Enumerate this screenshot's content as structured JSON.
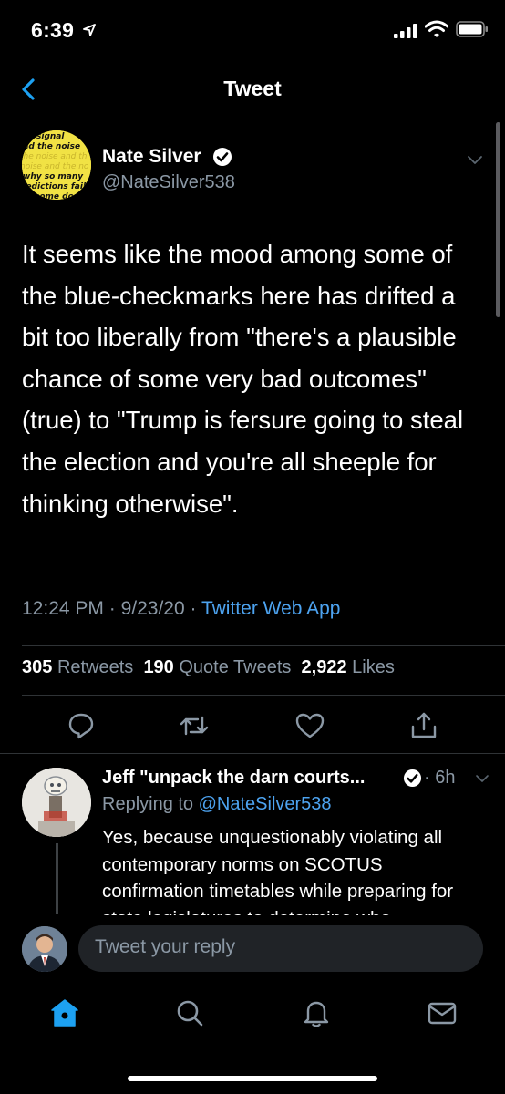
{
  "status_bar": {
    "time": "6:39"
  },
  "header": {
    "title": "Tweet"
  },
  "tweet": {
    "author_name": "Nate Silver",
    "author_handle": "@NateSilver538",
    "avatar_words": [
      "signal",
      "nd the noise",
      "the noise and th",
      "noise and the no",
      "why so many",
      "redictions fail",
      "some don"
    ],
    "text": "It seems like the mood among some of the blue-checkmarks here has drifted a bit too liberally from \"there's a plausible chance of some very bad outcomes\" (true) to \"Trump is fersure going to steal the election and you're all sheeple for thinking otherwise\".",
    "time": "12:24 PM",
    "date": "9/23/20",
    "separator": "·",
    "app": "Twitter Web App",
    "retweets_count": "305",
    "retweets_label": "Retweets",
    "quotes_count": "190",
    "quotes_label": "Quote Tweets",
    "likes_count": "2,922",
    "likes_label": "Likes"
  },
  "reply": {
    "author_name": "Jeff \"unpack the darn courts...",
    "time": "· 6h",
    "replying_prefix": "Replying to ",
    "replying_to": "@NateSilver538",
    "text": "Yes, because unquestionably violating all contemporary norms on SCOTUS confirmation timetables while preparing for state legislatures to determine who"
  },
  "composer": {
    "placeholder": "Tweet your reply"
  },
  "colors": {
    "accent": "#1da1f2",
    "link": "#4da3f0",
    "muted": "#8b98a5",
    "divider": "#2f3336"
  },
  "icons": {
    "status": [
      "location-arrow-icon",
      "signal-icon",
      "wifi-icon",
      "battery-icon"
    ],
    "actions": [
      "reply-icon",
      "retweet-icon",
      "like-icon",
      "share-icon"
    ],
    "tabs": [
      "home-icon",
      "search-icon",
      "notifications-icon",
      "messages-icon"
    ]
  }
}
